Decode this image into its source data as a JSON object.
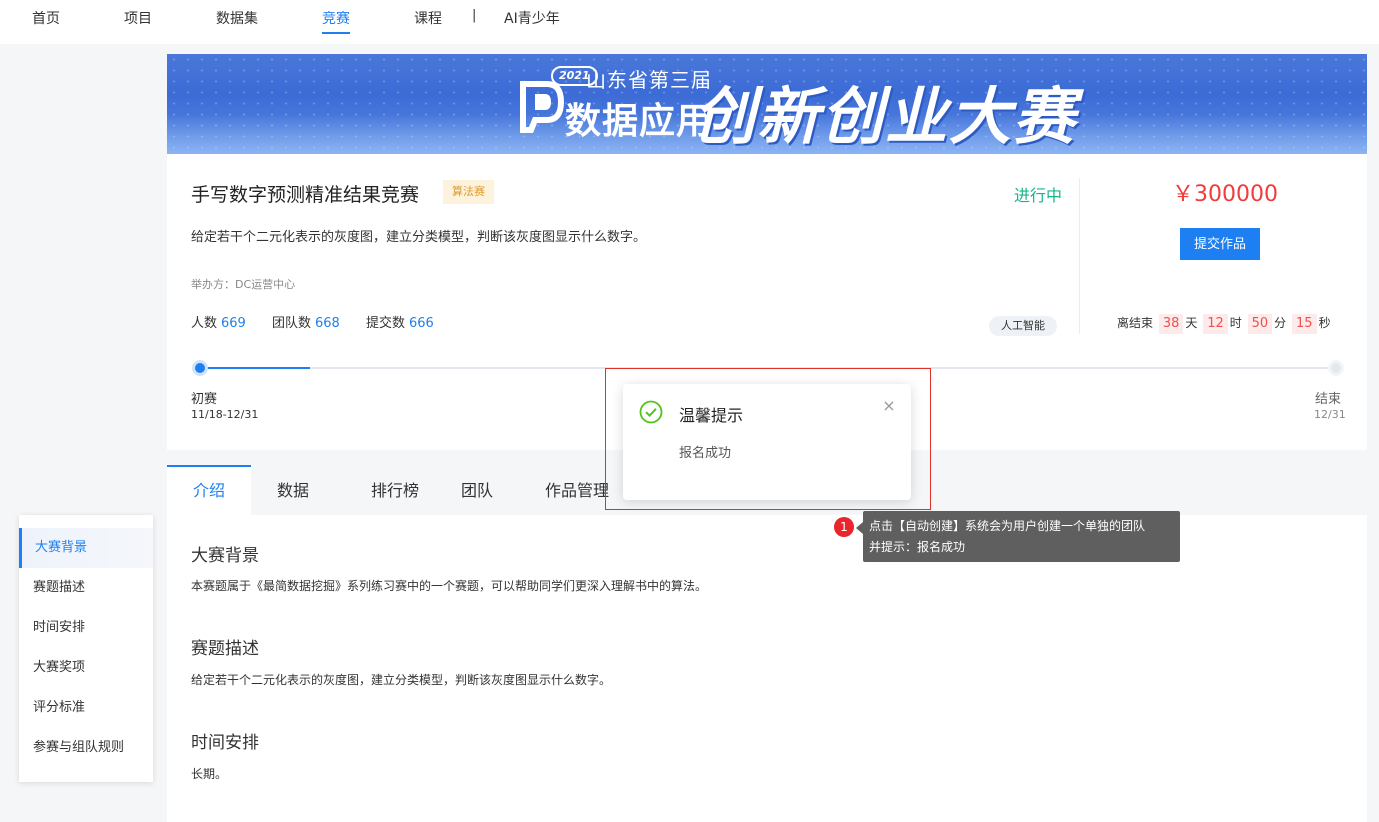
{
  "nav": {
    "items": [
      "首页",
      "项目",
      "数据集",
      "竞赛",
      "课程"
    ],
    "separator": "|",
    "extra": "AI青少年"
  },
  "banner": {
    "year": "2021",
    "subtitle": "山东省第三届",
    "app_title": "数据应用",
    "big_title": "创新创业大赛"
  },
  "competition": {
    "title": "手写数字预测精准结果竞赛",
    "tag": "算法赛",
    "status": "进行中",
    "description": "给定若干个二元化表示的灰度图，建立分类模型，判断该灰度图显示什么数字。",
    "organizer": "举办方：DC运营中心",
    "stats": [
      {
        "label": "人数",
        "value": "669"
      },
      {
        "label": "团队数",
        "value": "668"
      },
      {
        "label": "提交数",
        "value": "666"
      }
    ],
    "field_tag": "人工智能",
    "prize": "￥300000",
    "submit_label": "提交作品",
    "countdown": {
      "prefix": "离结束",
      "days": "38",
      "days_unit": "天",
      "hours": "12",
      "hours_unit": "时",
      "minutes": "50",
      "minutes_unit": "分",
      "seconds": "15",
      "seconds_unit": "秒"
    }
  },
  "timeline": {
    "start_label": "初赛",
    "start_date": "11/18-12/31",
    "end_label": "结束",
    "end_date": "12/31"
  },
  "tabs": [
    "介绍",
    "数据",
    "排行榜",
    "团队",
    "作品管理"
  ],
  "side_nav": [
    "大赛背景",
    "赛题描述",
    "时间安排",
    "大赛奖项",
    "评分标准",
    "参赛与组队规则"
  ],
  "sections": [
    {
      "title": "大赛背景",
      "text": "本赛题属于《最简数据挖掘》系列练习赛中的一个赛题，可以帮助同学们更深入理解书中的算法。"
    },
    {
      "title": "赛题描述",
      "text": "给定若干个二元化表示的灰度图，建立分类模型，判断该灰度图显示什么数字。"
    },
    {
      "title": "时间安排",
      "text": "长期。"
    }
  ],
  "notification": {
    "title": "温馨提示",
    "message": "报名成功",
    "close": "×",
    "icon": "check-circle-icon"
  },
  "annotation": {
    "badge": "1",
    "line1": "点击【自动创建】系统会为用户创建一个单独的团队",
    "line2": "并提示：报名成功"
  },
  "colors": {
    "primary": "#1e7ff2",
    "success": "#19b48c",
    "prize": "#f03c3c",
    "tag_bg": "#fdf3dc",
    "tag_text": "#e09a2e",
    "annotation_bg": "#5f5f5f",
    "highlight": "#e0302b"
  }
}
